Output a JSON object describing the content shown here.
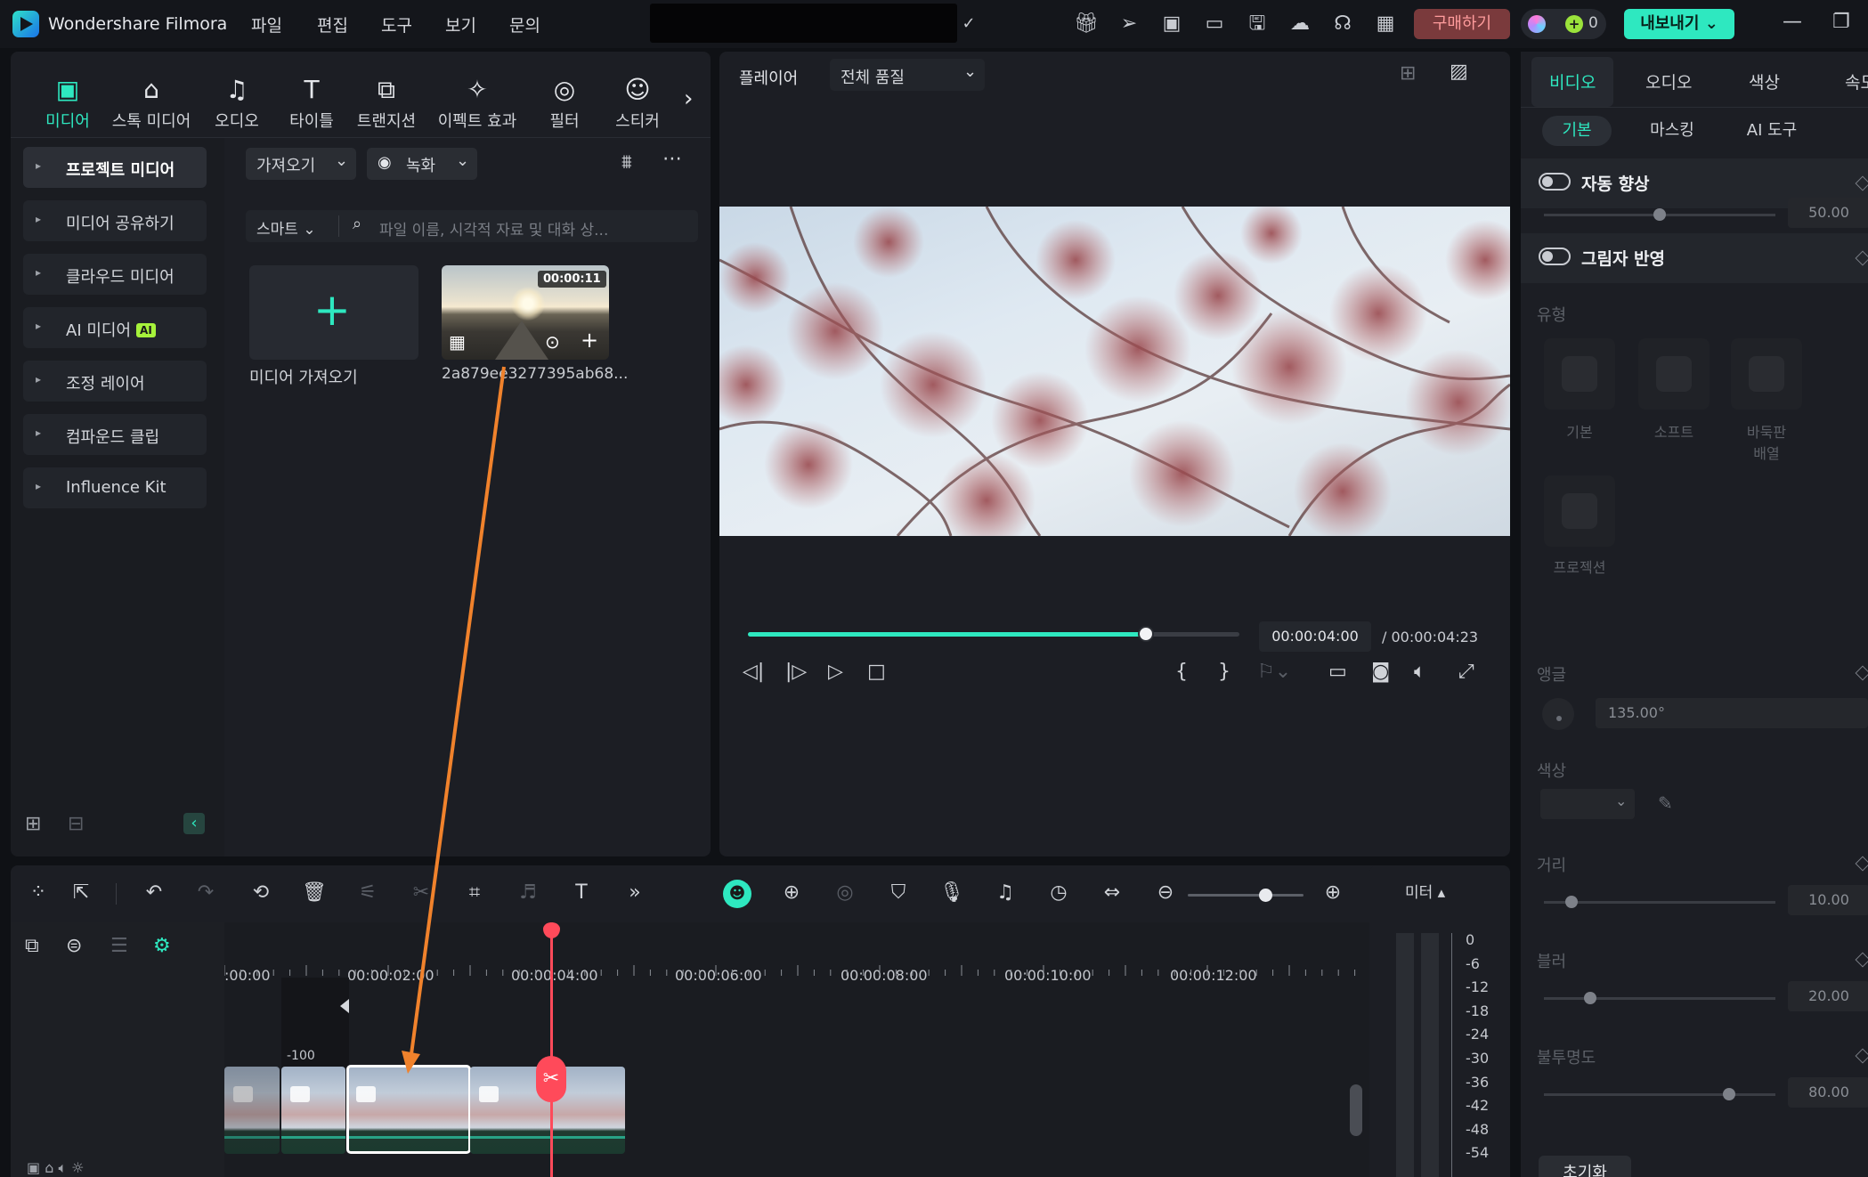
{
  "app": {
    "title": "Wondershare Filmora"
  },
  "menu": [
    "파일",
    "편집",
    "도구",
    "보기",
    "문의"
  ],
  "topbar": {
    "buy": "구매하기",
    "credits": "0",
    "export": "내보내기"
  },
  "media_tabs": [
    "미디어",
    "스톡 미디어",
    "오디오",
    "타이틀",
    "트랜지션",
    "이펙트 효과",
    "필터",
    "스티커"
  ],
  "tree": [
    "프로젝트 미디어",
    "미디어 공유하기",
    "클라우드 미디어",
    "AI 미디어",
    "조정 레이어",
    "컴파운드 클립",
    "Influence Kit"
  ],
  "tree_ai_badge": "AI",
  "media": {
    "import_btn": "가져오기",
    "record_btn": "녹화",
    "smart": "스마트",
    "search_placeholder": "파일 이름, 시각적 자료 및 대화 상...",
    "import_card_label": "미디어 가져오기",
    "clip_name": "2a879ee3277395ab68...",
    "clip_duration": "00:00:11"
  },
  "preview": {
    "player": "플레이어",
    "quality": "전체 품질",
    "time_current": "00:00:04:00",
    "time_total": "/  00:00:04:23",
    "progress": 0.81
  },
  "timeline": {
    "ruler": [
      ":00:00",
      "00:00:02:00",
      "00:00:04:00",
      "00:00:06:00",
      "00:00:08:00",
      "00:00:10:00",
      "00:00:12:00"
    ],
    "track_value": "-100",
    "zoom": 0.68
  },
  "meter": {
    "title": "미터 ▴",
    "scale": [
      "0",
      "-6",
      "-12",
      "-18",
      "-24",
      "-30",
      "-36",
      "-42",
      "-48",
      "-54"
    ]
  },
  "inspector": {
    "tabs": [
      "비디오",
      "오디오",
      "색상",
      "속도"
    ],
    "subtabs": [
      "기본",
      "마스킹",
      "AI 도구"
    ],
    "auto_enhance": "자동 향상",
    "auto_enhance_value": "50.00",
    "shadow": "그림자 반영",
    "type_label": "유형",
    "types": [
      "기본",
      "소프트",
      "바둑판\n배열",
      "프로젝션"
    ],
    "angle_label": "앵글",
    "angle_value": "135.00°",
    "color_label": "색상",
    "distance_label": "거리",
    "distance_value": "10.00",
    "blur_label": "블러",
    "blur_value": "20.00",
    "opacity_label": "불투명도",
    "opacity_value": "80.00",
    "reset": "초기화",
    "auto_enhance_level": 0.5,
    "distance_level": 0.12,
    "blur_level": 0.2,
    "opacity_level": 0.8
  }
}
